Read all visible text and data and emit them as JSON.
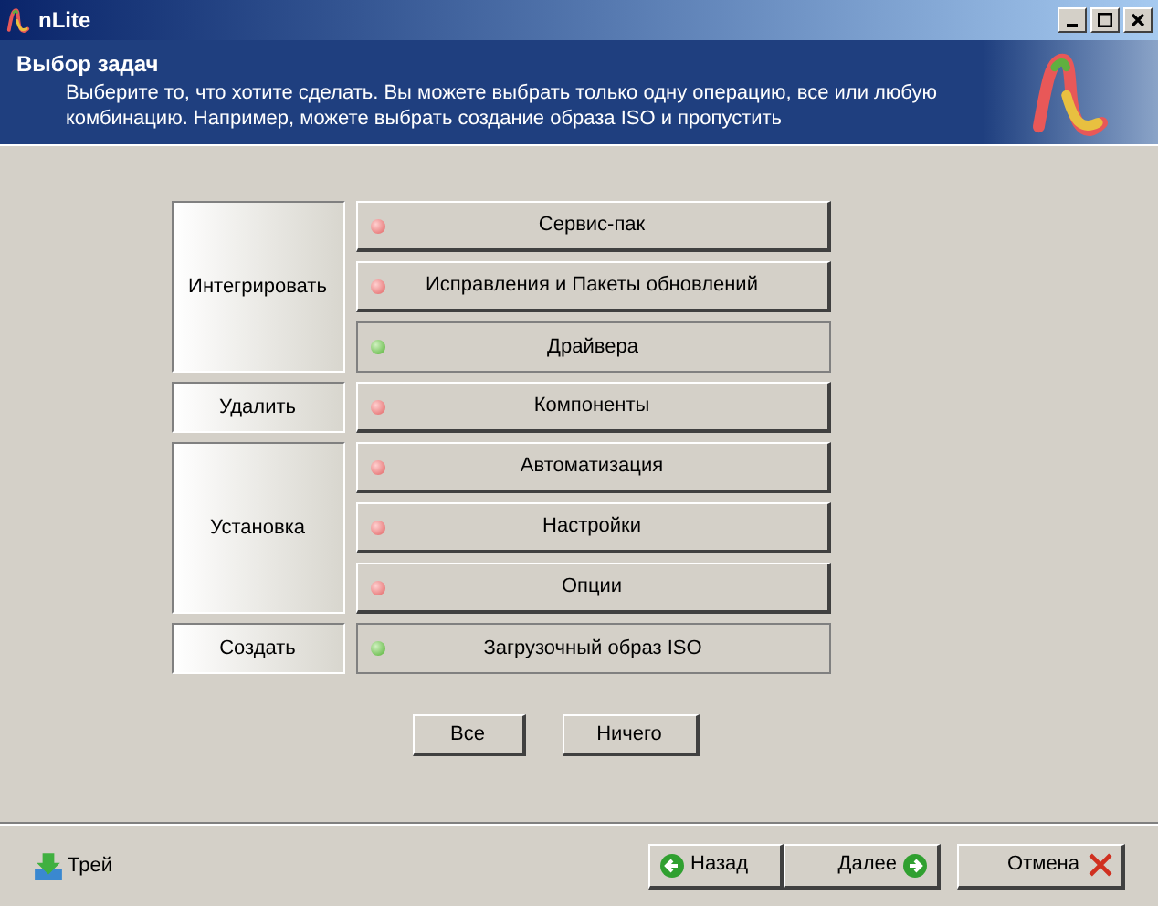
{
  "window": {
    "title": "nLite"
  },
  "header": {
    "title": "Выбор задач",
    "description": "Выберите то, что хотите сделать. Вы можете выбрать только одну операцию, все или любую комбинацию. Например, можете выбрать создание образа ISO и пропустить"
  },
  "groups": [
    {
      "label": "Интегрировать",
      "tasks": [
        {
          "label": "Сервис-пак",
          "selected": false
        },
        {
          "label": "Исправления и Пакеты обновлений",
          "selected": false
        },
        {
          "label": "Драйвера",
          "selected": true
        }
      ]
    },
    {
      "label": "Удалить",
      "tasks": [
        {
          "label": "Компоненты",
          "selected": false
        }
      ]
    },
    {
      "label": "Установка",
      "tasks": [
        {
          "label": "Автоматизация",
          "selected": false
        },
        {
          "label": "Настройки",
          "selected": false
        },
        {
          "label": "Опции",
          "selected": false
        }
      ]
    },
    {
      "label": "Создать",
      "tasks": [
        {
          "label": "Загрузочный образ ISO",
          "selected": true
        }
      ]
    }
  ],
  "select_buttons": [
    "Все",
    "Ничего"
  ],
  "footer": {
    "tray": "Трей",
    "back": "Назад",
    "next": "Далее",
    "cancel": "Отмена"
  }
}
